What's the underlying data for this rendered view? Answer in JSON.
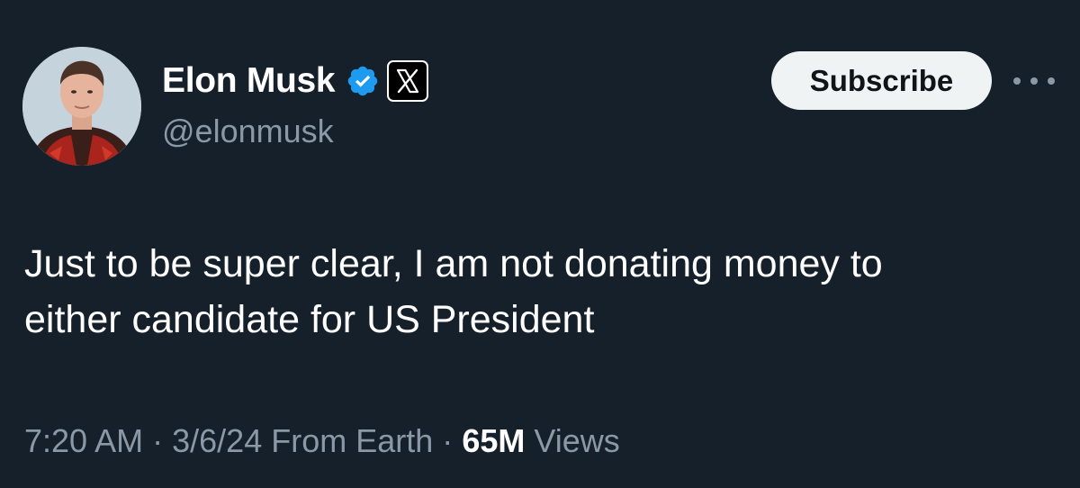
{
  "author": {
    "display_name": "Elon Musk",
    "handle": "@elonmusk",
    "verified": true,
    "verified_badge_icon": "verified-checkmark-icon",
    "affiliation_badge_icon": "x-logo-icon"
  },
  "actions": {
    "subscribe_label": "Subscribe",
    "more_icon": "more-horizontal-icon"
  },
  "tweet": {
    "text": "Just to be super clear, I am not donating money to\neither candidate for US President"
  },
  "meta": {
    "time": "7:20 AM",
    "separator": "·",
    "date": "3/6/24",
    "location": "From Earth",
    "views_count": "65M",
    "views_label": "Views"
  },
  "colors": {
    "background": "#15202b",
    "primary_text": "#ffffff",
    "secondary_text": "#8b98a5",
    "verified_blue": "#1d9bf0",
    "button_background": "#eff3f4"
  }
}
